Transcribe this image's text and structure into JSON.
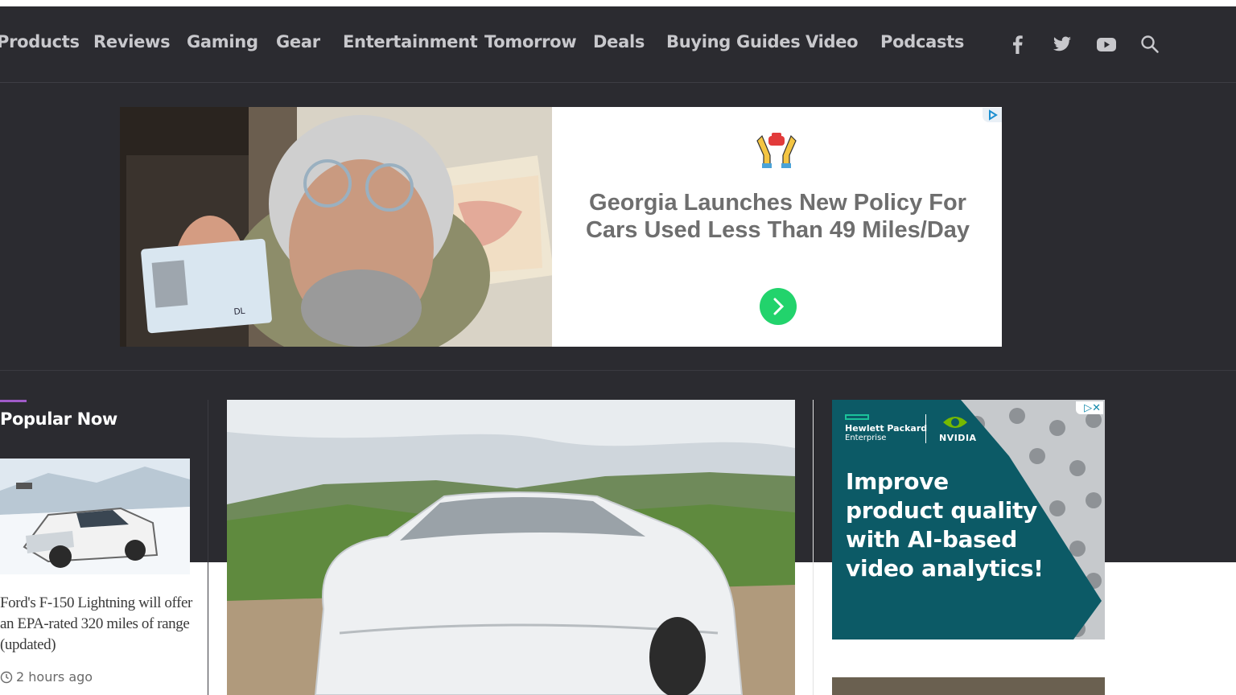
{
  "nav": {
    "items": [
      "Products",
      "Reviews",
      "Gaming",
      "Gear",
      "Entertainment",
      "Tomorrow",
      "Deals",
      "Buying Guides",
      "Video",
      "Podcasts"
    ],
    "icons": [
      "facebook-icon",
      "twitter-icon",
      "youtube-icon",
      "search-icon"
    ]
  },
  "ad_banner": {
    "headline": "Georgia Launches New Policy For Cars Used Less Than 49 Miles/Day",
    "license_label": "DL"
  },
  "popular": {
    "title": "Popular Now",
    "story_title": "Ford's F-150 Lightning will offer an EPA-rated 320 miles of range (updated)",
    "story_time": "2 hours ago"
  },
  "side_ad": {
    "brand1_line1": "Hewlett Packard",
    "brand1_line2": "Enterprise",
    "brand2": "NVIDIA",
    "headline": "Improve product quality with AI-based video analytics!"
  },
  "colors": {
    "background": "#2b2b30",
    "accent": "#a05bc8",
    "ad_button": "#22d36c",
    "side_ad_bg": "#0c5a66"
  }
}
